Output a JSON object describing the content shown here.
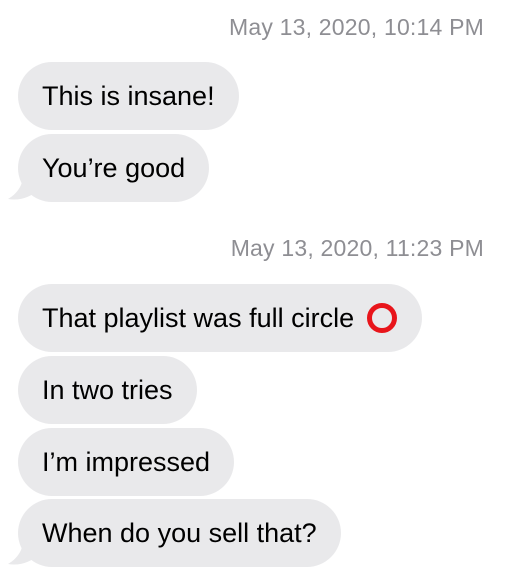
{
  "conversation": {
    "groups": [
      {
        "timestamp": "May 13, 2020, 10:14 PM",
        "messages": [
          {
            "text": "This is insane!"
          },
          {
            "text": "You’re good"
          }
        ]
      },
      {
        "timestamp": "May 13, 2020, 11:23 PM",
        "messages": [
          {
            "text": "That playlist was full circle",
            "trailing_icon": "hollow-red-circle-icon"
          },
          {
            "text": "In two tries"
          },
          {
            "text": "I’m impressed"
          },
          {
            "text": "When do you sell that?"
          }
        ]
      }
    ]
  },
  "colors": {
    "bubble_background": "#e9e9eb",
    "timestamp_text": "#8e8e93",
    "message_text": "#000000",
    "page_background": "#ffffff",
    "circle_icon": "#e8151b"
  }
}
